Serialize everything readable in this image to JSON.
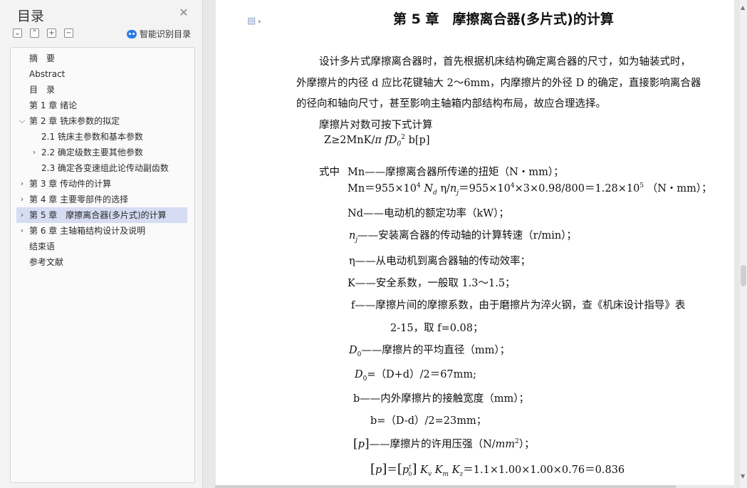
{
  "toc": {
    "title": "目录",
    "close_icon": "close-icon",
    "tools": [
      "collapse-all-icon",
      "expand-all-icon",
      "add-heading-icon",
      "remove-heading-icon"
    ],
    "smart_label": "智能识别目录",
    "smart_icon": "ai-robot-icon",
    "items": [
      {
        "label": "摘　要",
        "level": 1,
        "expandable": false,
        "expanded": false,
        "selected": false
      },
      {
        "label": "Abstract",
        "level": 1,
        "expandable": false,
        "expanded": false,
        "selected": false
      },
      {
        "label": "目　录",
        "level": 1,
        "expandable": false,
        "expanded": false,
        "selected": false
      },
      {
        "label": "第 1 章  绪论",
        "level": 1,
        "expandable": false,
        "expanded": false,
        "selected": false
      },
      {
        "label": "第 2 章  铣床参数的拟定",
        "level": 1,
        "expandable": true,
        "expanded": true,
        "selected": false
      },
      {
        "label": "2.1 铣床主参数和基本参数",
        "level": 2,
        "expandable": false,
        "expanded": false,
        "selected": false
      },
      {
        "label": "2.2 确定级数主要其他参数",
        "level": 2,
        "expandable": true,
        "expanded": false,
        "selected": false
      },
      {
        "label": "2.3  确定各变速组此论传动副齿数",
        "level": 2,
        "expandable": false,
        "expanded": false,
        "selected": false
      },
      {
        "label": "第 3 章  传动件的计算",
        "level": 1,
        "expandable": true,
        "expanded": false,
        "selected": false
      },
      {
        "label": "第 4 章  主要零部件的选择",
        "level": 1,
        "expandable": true,
        "expanded": false,
        "selected": false
      },
      {
        "label": "第 5 章　摩擦离合器(多片式)的计算",
        "level": 1,
        "expandable": true,
        "expanded": false,
        "selected": true
      },
      {
        "label": "第 6 章  主轴箱结构设计及说明",
        "level": 1,
        "expandable": true,
        "expanded": false,
        "selected": false
      },
      {
        "label": "结束语",
        "level": 1,
        "expandable": false,
        "expanded": false,
        "selected": false
      },
      {
        "label": "参考文献",
        "level": 1,
        "expandable": false,
        "expanded": false,
        "selected": false
      }
    ]
  },
  "doc": {
    "heading": "第 5 章　摩擦离合器(多片式)的计算",
    "para1_l1": "设计多片式摩擦离合器时，首先根据机床结构确定离合器的尺寸，如为轴装式时，",
    "para1_l2": "外摩擦片的内径 d 应比花键轴大 2～6mm，内摩擦片的外径 D 的确定，直接影响离合器",
    "para1_l3": "的径向和轴向尺寸，甚至影响主轴箱内部结构布局，故应合理选择。",
    "pairs_intro": "摩擦片对数可按下式计算",
    "formula_z": {
      "a": "Z≥2MnK/",
      "pi": "π",
      "f": "f",
      "D": "D",
      "sub0": "0",
      "sup2": "2",
      "rest": "b[p]"
    },
    "where": "式中",
    "mn_def": "Mn——摩擦离合器所传递的扭矩（N・mm）；",
    "mn_calc": {
      "a": "Mn＝955×10",
      "e4": "4",
      "Nd": "N",
      "d": "d",
      "eta": "η/",
      "nj": "n",
      "j": "j",
      "b": "＝955×10",
      "e4b": "4",
      "c": "×3×0.98/800＝1.28×10",
      "e5": "5",
      "unit": "（N・mm）；"
    },
    "nd_def": "Nd——电动机的额定功率（kW）；",
    "nj_def": {
      "n": "n",
      "j": "j",
      "text": "——安装离合器的传动轴的计算转速（r/min）；"
    },
    "eta_def": "η——从电动机到离合器轴的传动效率；",
    "k_def": "K——安全系数，一般取 1.3～1.5；",
    "f_def_l1": "f——摩擦片间的摩擦系数，由于磨擦片为淬火钢，查《机床设计指导》表",
    "f_def_l2": "2-15，取 f=0.08；",
    "d0_def": {
      "D": "D",
      "sub": "0",
      "text": "——摩擦片的平均直径（mm）；"
    },
    "d0_calc": {
      "D": "D",
      "sub": "0",
      "text": "=（D+d）/2＝67mm;"
    },
    "b_def": "b——内外摩擦片的接触宽度（mm）；",
    "b_calc": "b=（D-d）/2=23mm；",
    "p_def": {
      "l": "[",
      "p": "p",
      "r": "]",
      "text": "——摩擦片的许用压强（N/",
      "mm": "mm",
      "sup": "2",
      "end": "）；"
    },
    "p_calc": {
      "l": "[",
      "p": "p",
      "r": "]",
      "eq": "＝",
      "l2": "[",
      "p0": "p",
      "t": "t",
      "zero": "0",
      "r2": "]",
      "Kv": "K",
      "v": "v",
      "Km": "K",
      "m": "m",
      "Kz": "K",
      "z": "z",
      "val": "＝1.1×1.00×1.00×0.76＝0.836"
    },
    "doc_icon": "document-icon"
  }
}
